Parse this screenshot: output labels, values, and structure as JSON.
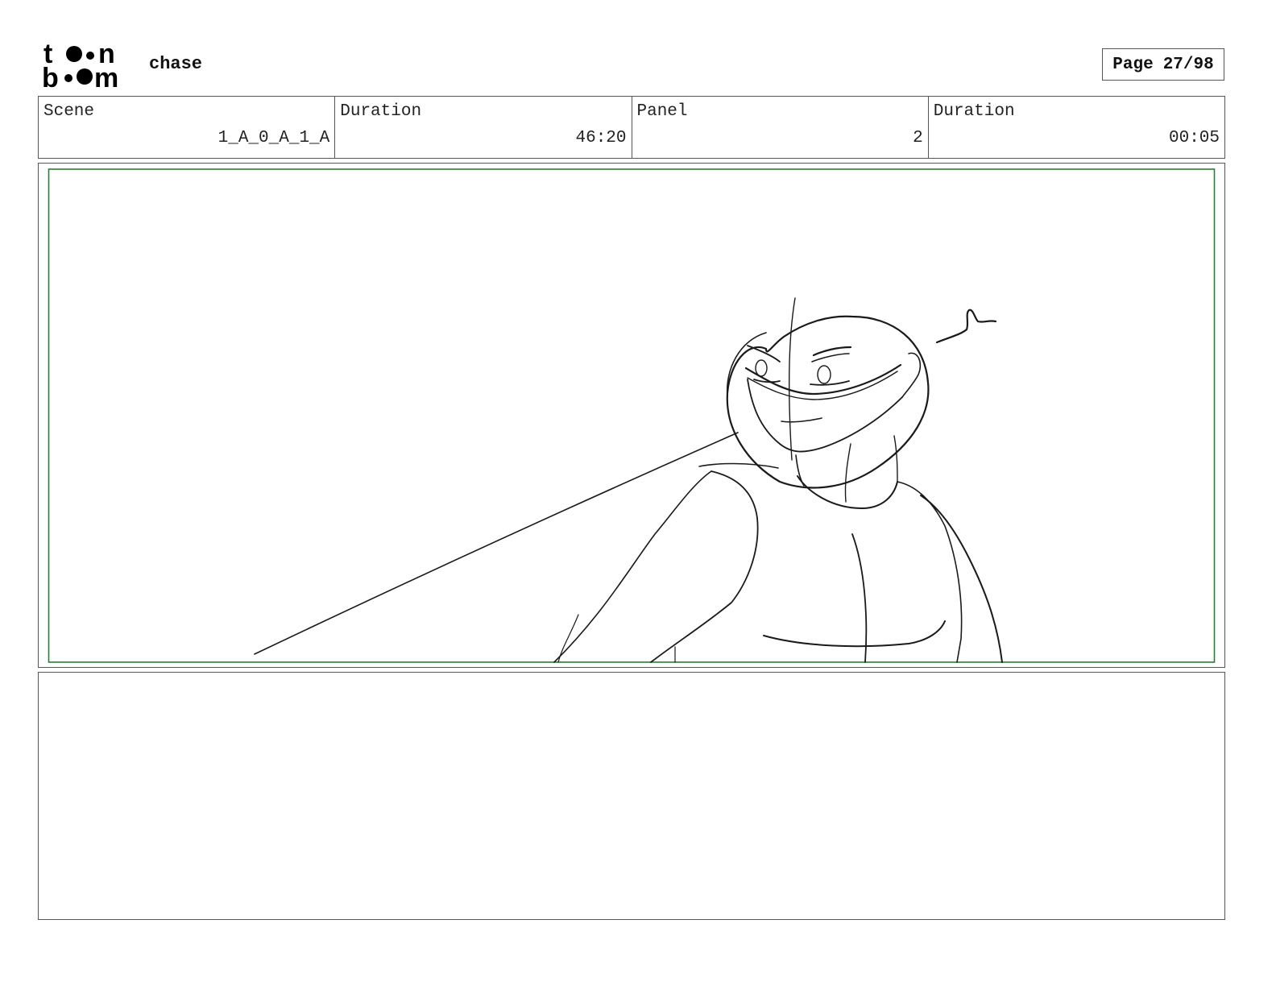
{
  "header": {
    "logo_text": "toon boom",
    "title": "chase",
    "page_label": "Page",
    "page_number": "27/98"
  },
  "info": {
    "scene_label": "Scene",
    "scene_value": "1_A_0_A_1_A",
    "scene_duration_label": "Duration",
    "scene_duration_value": "46:20",
    "panel_label": "Panel",
    "panel_value": "2",
    "panel_duration_label": "Duration",
    "panel_duration_value": "00:05"
  },
  "panel": {
    "safe_frame_color": "#2e7d32",
    "sketch_line_color": "#1a1a1a"
  },
  "notes": {
    "text": ""
  }
}
